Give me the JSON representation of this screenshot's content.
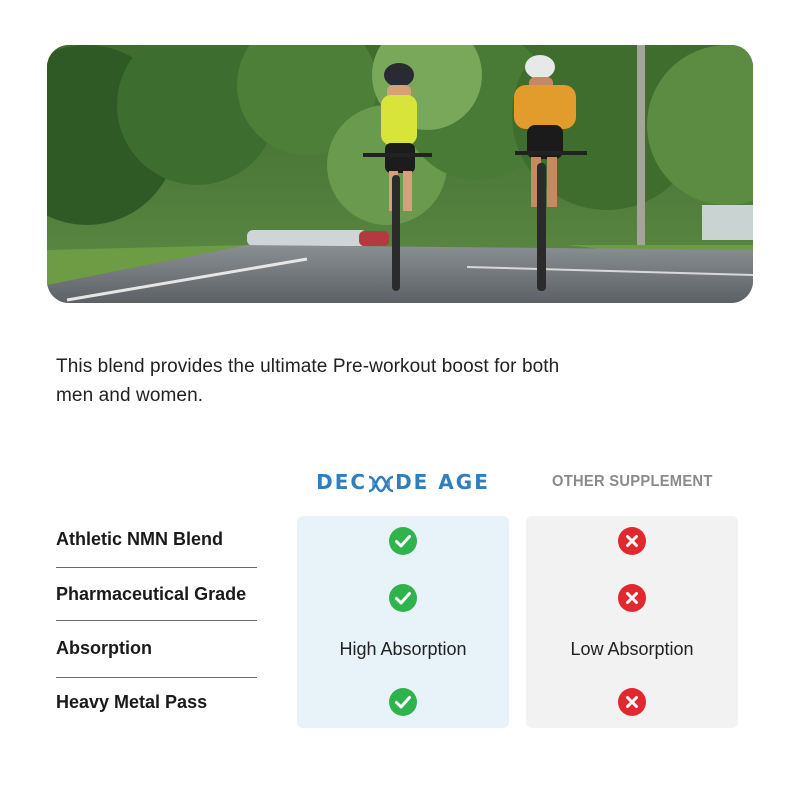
{
  "intro": {
    "text": "This blend provides the ultimate Pre-workout boost for both men and women."
  },
  "comparison": {
    "brand_logo": "DECODE AGE",
    "brand_color": "#2f7fc0",
    "other_label": "OTHER SUPPLEMENT",
    "rows": [
      {
        "label": "Athletic NMN Blend",
        "decode": "check-icon",
        "other": "cross-icon"
      },
      {
        "label": "Pharmaceutical Grade",
        "decode": "check-icon",
        "other": "cross-icon"
      },
      {
        "label": "Absorption",
        "decode_text": "High Absorption",
        "other_text": "Low Absorption"
      },
      {
        "label": "Heavy Metal Pass",
        "decode": "check-icon",
        "other": "cross-icon"
      }
    ],
    "check_color": "#2fb44d",
    "cross_color": "#e0282e",
    "decode_column_bg": "#e8f3f9",
    "other_column_bg": "#f2f2f2"
  }
}
